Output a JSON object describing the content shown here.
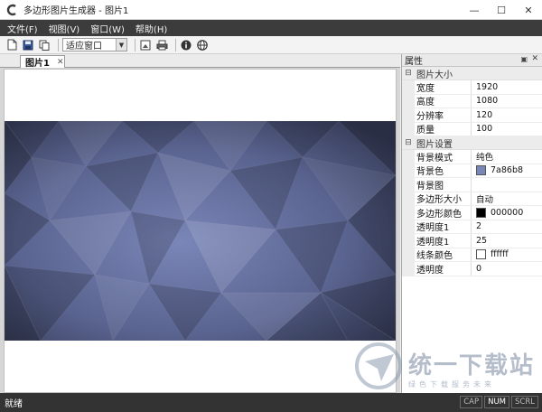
{
  "window": {
    "title": "多边形图片生成器 - 图片1",
    "minimize": "—",
    "maximize": "☐",
    "close": "✕"
  },
  "menu": {
    "items": [
      "文件(F)",
      "视图(V)",
      "窗口(W)",
      "帮助(H)"
    ]
  },
  "toolbar": {
    "zoom_select_value": "适应窗口",
    "zoom_arrow": "▼"
  },
  "document": {
    "tab_label": "图片1",
    "tab_close": "✕"
  },
  "properties": {
    "title": "属性",
    "pin": "▣",
    "close": "✕",
    "groups": [
      {
        "label": "图片大小",
        "toggle": "⊟",
        "rows": [
          {
            "key": "宽度",
            "value": "1920"
          },
          {
            "key": "高度",
            "value": "1080"
          },
          {
            "key": "分辨率",
            "value": "120"
          },
          {
            "key": "质量",
            "value": "100"
          }
        ]
      },
      {
        "label": "图片设置",
        "toggle": "⊟",
        "rows": [
          {
            "key": "背景模式",
            "value": "纯色"
          },
          {
            "key": "背景色",
            "value": "7a86b8",
            "swatch": "#7a86b8"
          },
          {
            "key": "背景图",
            "value": ""
          },
          {
            "key": "多边形大小",
            "value": "自动"
          },
          {
            "key": "多边形颜色",
            "value": "000000",
            "swatch": "#000000"
          },
          {
            "key": "透明度1",
            "value": "2"
          },
          {
            "key": "透明度1",
            "value": "25"
          },
          {
            "key": "线条颜色",
            "value": "ffffff",
            "swatch": "#ffffff"
          },
          {
            "key": "透明度",
            "value": "0"
          }
        ]
      }
    ]
  },
  "statusbar": {
    "text": "就绪",
    "indicators": [
      {
        "label": "CAP",
        "on": false
      },
      {
        "label": "NUM",
        "on": true
      },
      {
        "label": "SCRL",
        "on": false
      }
    ]
  },
  "watermark": {
    "text": "统一下载站",
    "sub": "绿色下载服务未来"
  },
  "colors": {
    "menubar": "#3c3c3c",
    "statusbar": "#333333",
    "polygon_base": "#7a86b8"
  }
}
